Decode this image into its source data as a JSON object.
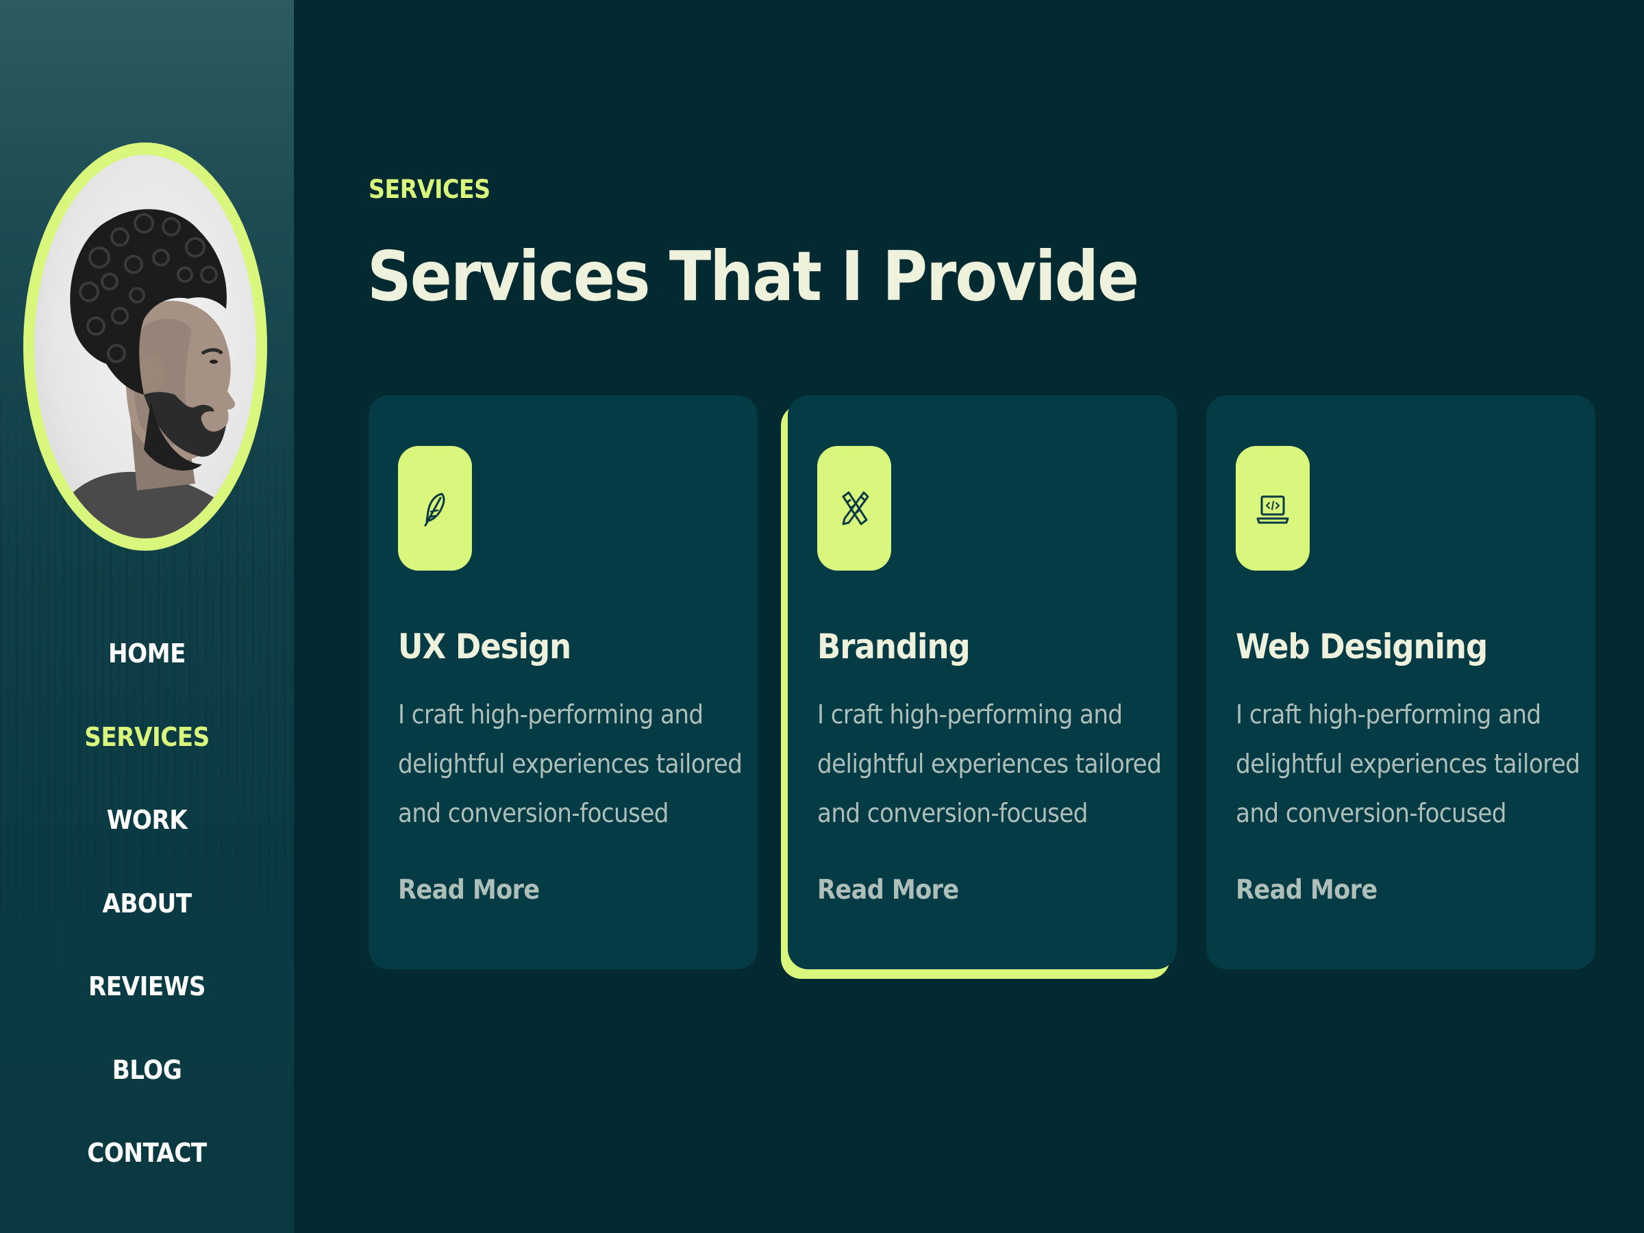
{
  "sidebar": {
    "avatar_alt": "Portrait of man with curly hair and beard",
    "nav": [
      {
        "label": "HOME",
        "active": false
      },
      {
        "label": "SERVICES",
        "active": true
      },
      {
        "label": "WORK",
        "active": false
      },
      {
        "label": "ABOUT",
        "active": false
      },
      {
        "label": "REVIEWS",
        "active": false
      },
      {
        "label": "BLOG",
        "active": false
      },
      {
        "label": "CONTACT",
        "active": false
      }
    ]
  },
  "main": {
    "eyebrow": "SERVICES",
    "title": "Services That I Provide",
    "cards": [
      {
        "icon": "feather-icon",
        "title": "UX Design",
        "description": "I craft high-performing and delightful experiences tailored and conversion-focused",
        "link": "Read More"
      },
      {
        "icon": "pencil-ruler-icon",
        "title": "Branding",
        "description": "I craft high-performing and delightful experiences tailored and conversion-focused",
        "link": "Read More",
        "highlighted": true
      },
      {
        "icon": "laptop-code-icon",
        "title": "Web Designing",
        "description": "I craft high-performing and delightful experiences tailored and conversion-focused",
        "link": "Read More"
      }
    ]
  },
  "colors": {
    "background": "#042a31",
    "card": "#043b45",
    "accent": "#d8f77c",
    "heading": "#eef2dc",
    "body_text": "#aebfb9"
  }
}
